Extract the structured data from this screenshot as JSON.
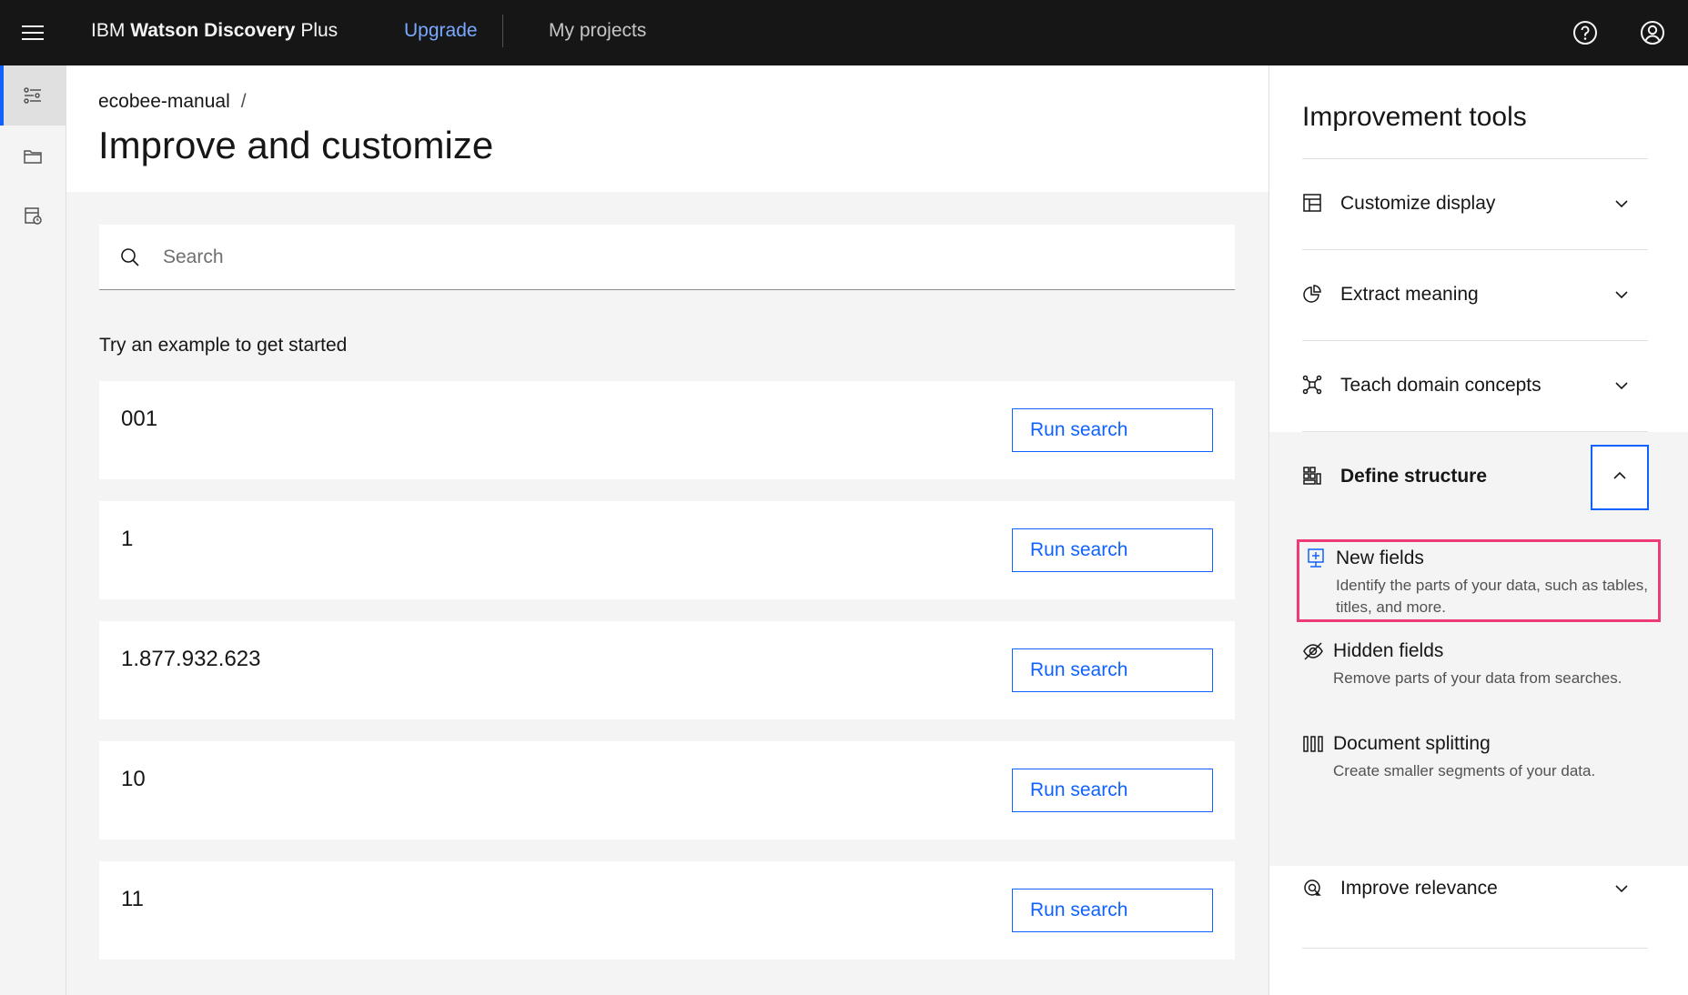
{
  "header": {
    "brand_prefix": "IBM",
    "brand_bold": "Watson Discovery",
    "brand_suffix": "Plus",
    "nav_upgrade": "Upgrade",
    "nav_projects": "My projects"
  },
  "breadcrumb": {
    "project": "ecobee-manual",
    "separator": "/"
  },
  "page": {
    "title": "Improve and customize"
  },
  "search": {
    "placeholder": "Search"
  },
  "examples": {
    "label": "Try an example to get started",
    "items": [
      {
        "text": "001",
        "button": "Run search"
      },
      {
        "text": "1",
        "button": "Run search"
      },
      {
        "text": "1.877.932.623",
        "button": "Run search"
      },
      {
        "text": "10",
        "button": "Run search"
      },
      {
        "text": "11",
        "button": "Run search"
      }
    ]
  },
  "panel": {
    "title": "Improvement tools",
    "items": [
      {
        "label": "Customize display",
        "icon": "layout-icon"
      },
      {
        "label": "Extract meaning",
        "icon": "pie-chart-icon"
      },
      {
        "label": "Teach domain concepts",
        "icon": "network-icon"
      },
      {
        "label": "Define structure",
        "icon": "grid-structure-icon"
      },
      {
        "label": "Improve relevance",
        "icon": "target-icon"
      }
    ],
    "sub_items": [
      {
        "title": "New fields",
        "desc": "Identify the parts of your data, such as tables, titles, and more."
      },
      {
        "title": "Hidden fields",
        "desc": "Remove parts of your data from searches."
      },
      {
        "title": "Document splitting",
        "desc": "Create smaller segments of your data."
      }
    ]
  },
  "colors": {
    "accent": "#0f62fe",
    "highlight": "#ee3a75",
    "header_bg": "#161616"
  }
}
